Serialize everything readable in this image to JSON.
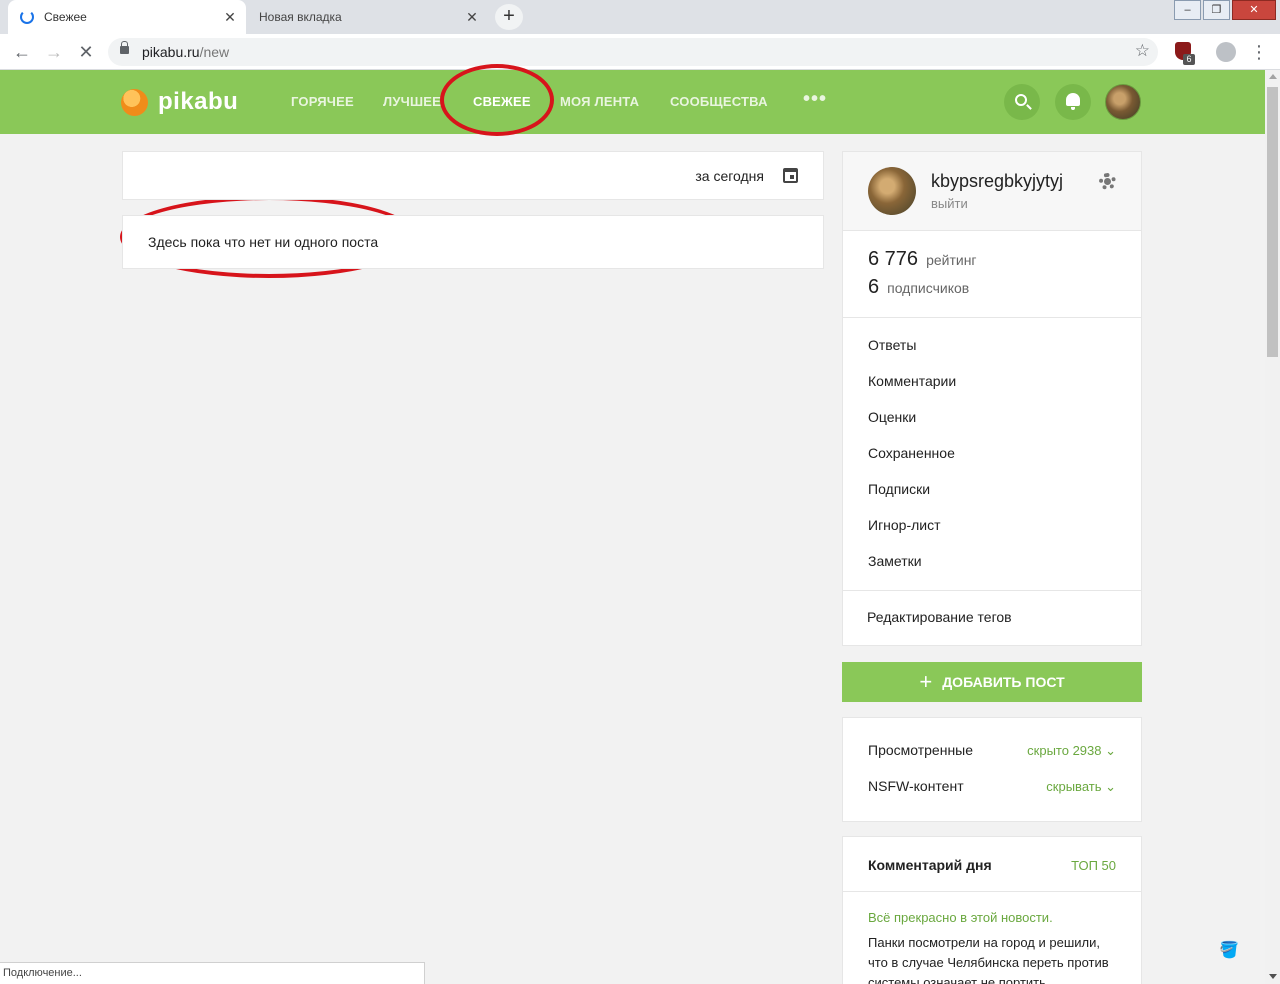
{
  "browser": {
    "tabs": [
      {
        "title": "Свежее"
      },
      {
        "title": "Новая вкладка"
      }
    ],
    "new_tab": "+",
    "url_host": "pikabu.ru",
    "url_path": "/new",
    "extension_badge": "6",
    "status": "Подключение..."
  },
  "header": {
    "logo": "pikabu",
    "nav": [
      "ГОРЯЧЕЕ",
      "ЛУЧШЕЕ",
      "СВЕЖЕЕ",
      "МОЯ ЛЕНТА",
      "СООБЩЕСТВА"
    ],
    "more": "•••",
    "current_nav": "СВЕЖЕЕ",
    "accent_color": "#8ac858",
    "annotation_color": "#d7141b"
  },
  "feed": {
    "period": "за сегодня",
    "empty_message": "Здесь пока что нет ни одного поста"
  },
  "profile": {
    "username": "kbypsregbkyjytyj",
    "logout": "выйти",
    "rating_value": "6 776",
    "rating_label": "рейтинг",
    "subscribers_value": "6",
    "subscribers_label": "подписчиков",
    "menu": [
      "Ответы",
      "Комментарии",
      "Оценки",
      "Сохраненное",
      "Подписки",
      "Игнор-лист",
      "Заметки"
    ],
    "edit_tags": "Редактирование тегов"
  },
  "add_post": {
    "plus": "+",
    "label": "ДОБАВИТЬ ПОСТ"
  },
  "settings": {
    "viewed_label": "Просмотренные",
    "viewed_value": "скрыто 2938 ⌄",
    "nsfw_label": "NSFW-контент",
    "nsfw_value": "скрывать ⌄"
  },
  "comment_of_day": {
    "title": "Комментарий дня",
    "top": "ТОП 50",
    "link": "Всё прекрасно в этой новости.",
    "text": "Панки посмотрели на город и решили, что в случае Челябинска переть против системы означает не портить"
  },
  "icons": [
    "spinner-icon",
    "close-icon",
    "back-icon",
    "forward-icon",
    "stop-icon",
    "lock-icon",
    "star-icon",
    "profile-icon",
    "menu-icon",
    "search-icon",
    "bell-icon",
    "avatar",
    "calendar-icon",
    "gear-icon",
    "plus-icon",
    "paint-bucket-icon"
  ]
}
